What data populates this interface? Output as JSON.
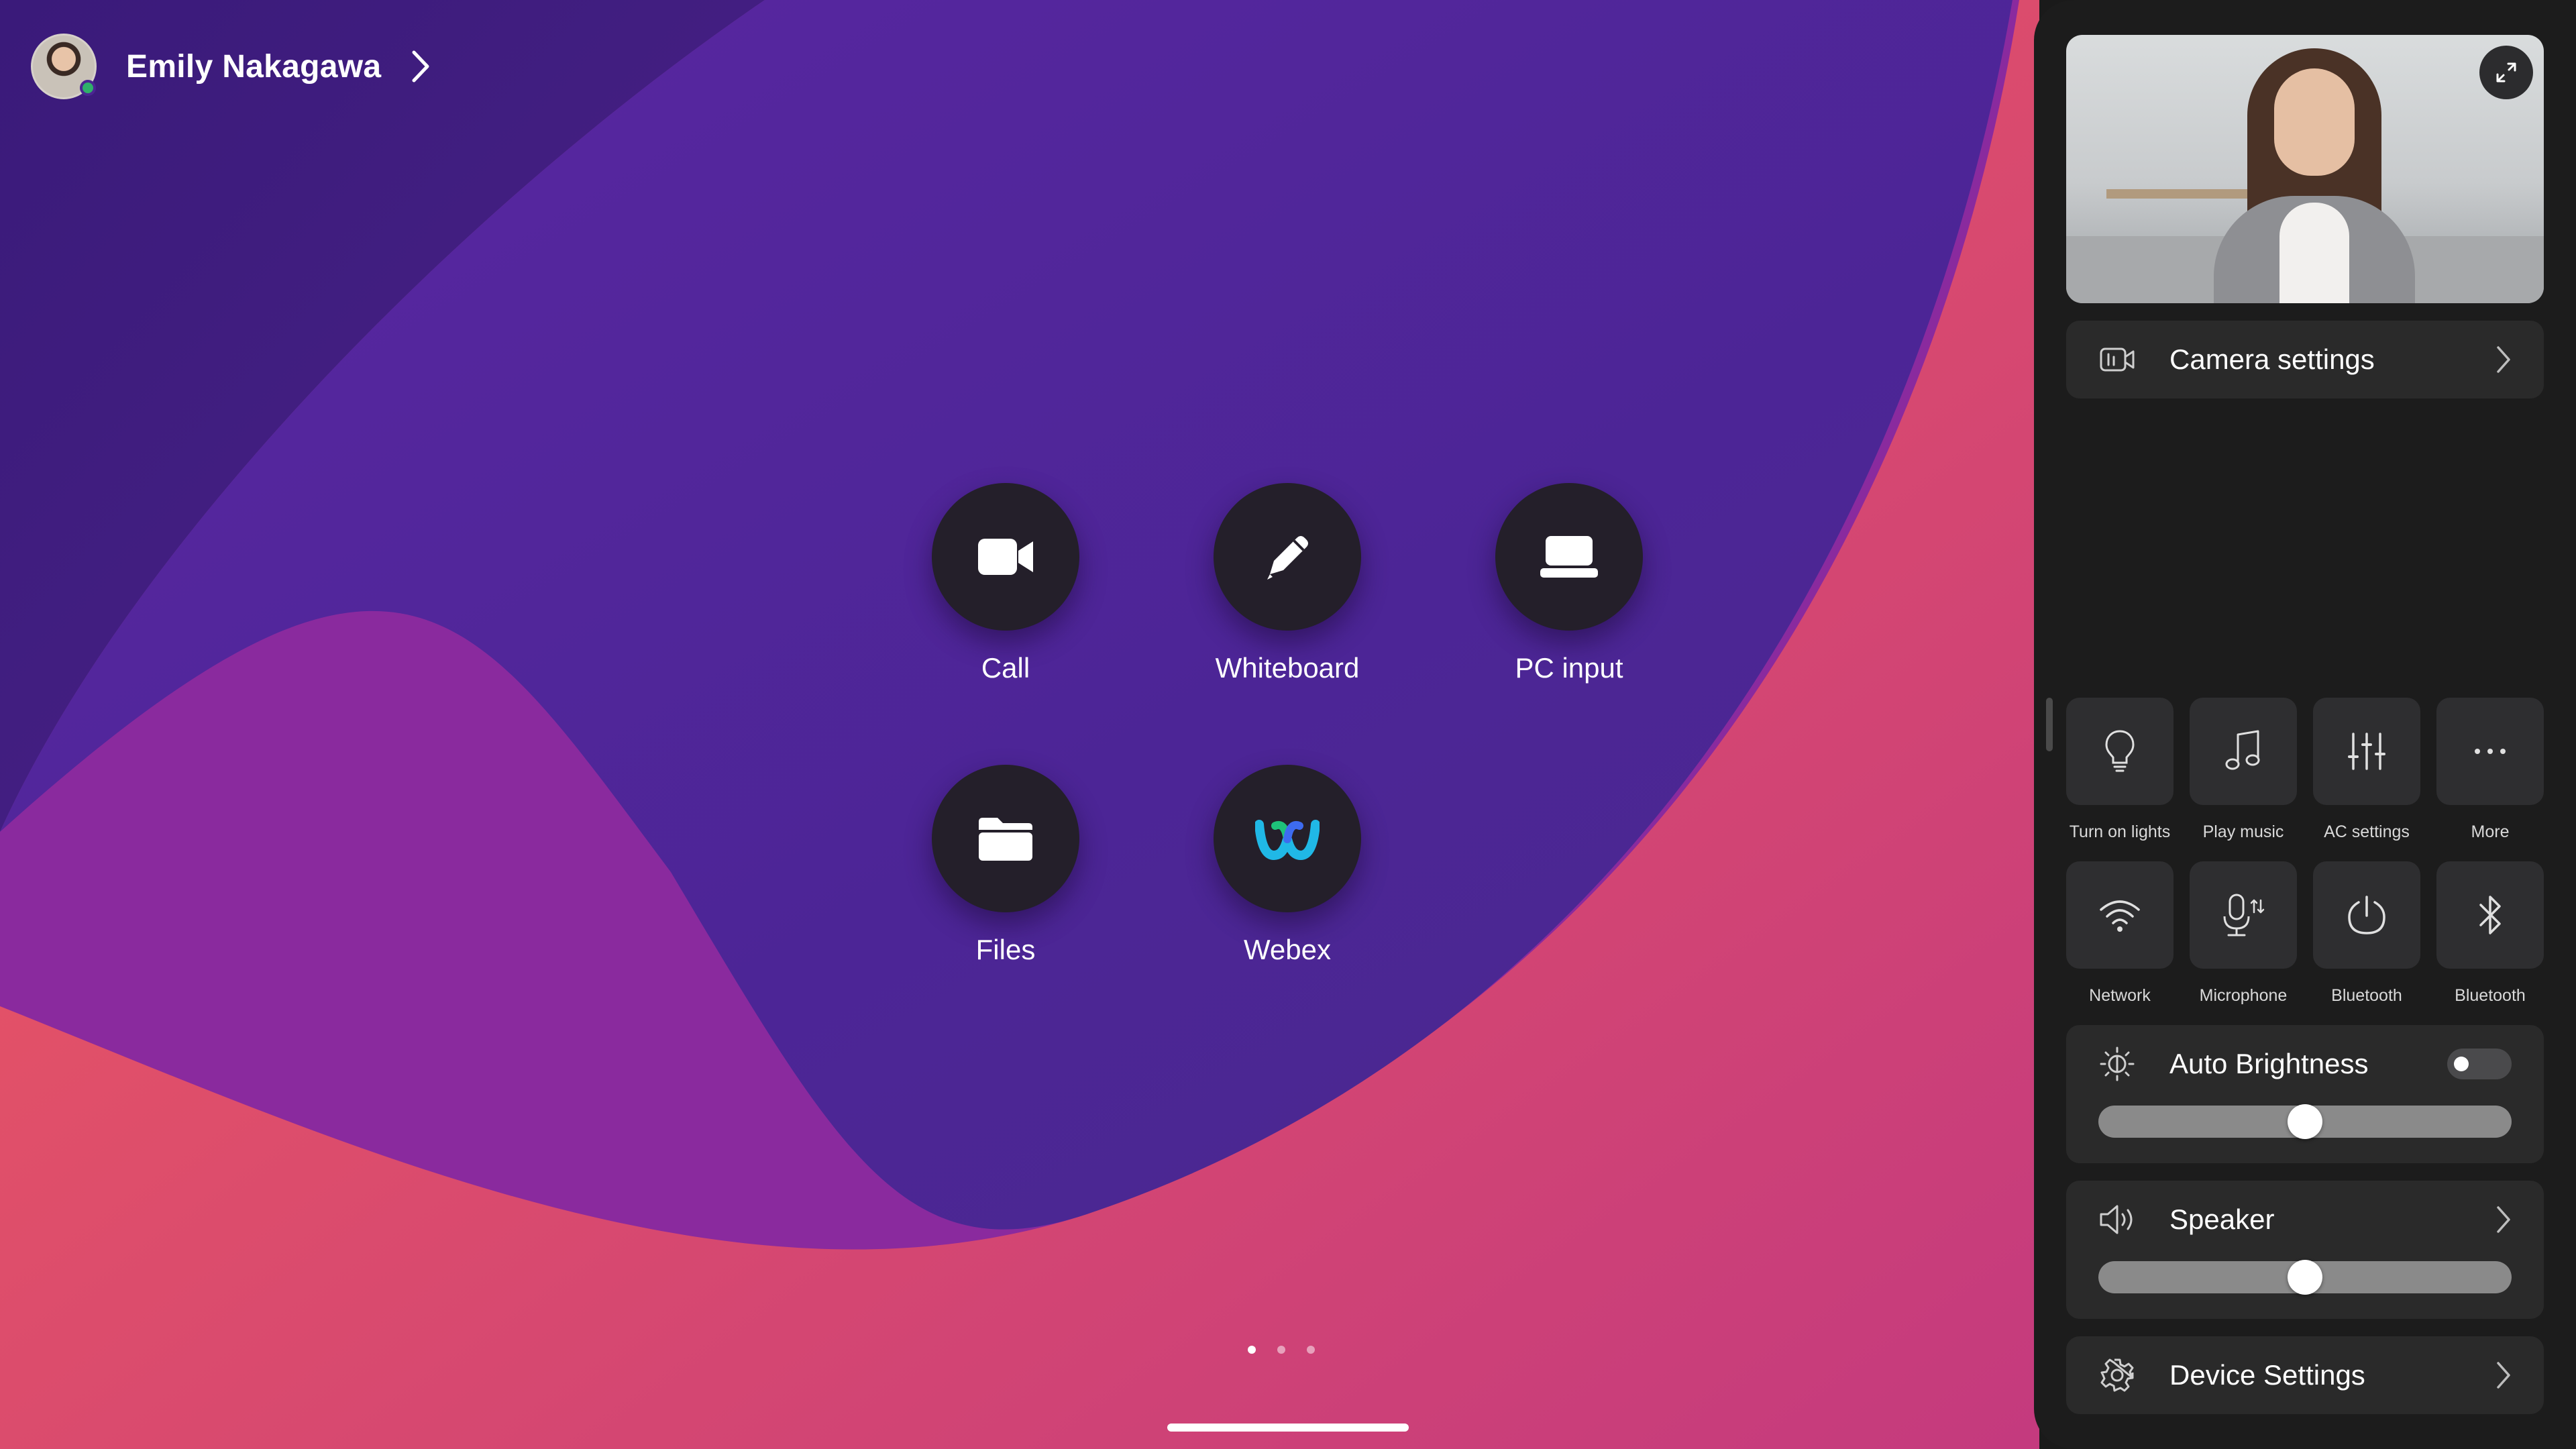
{
  "user": {
    "name": "Emily Nakagawa",
    "presence": "online",
    "presence_color": "#2fb06a"
  },
  "launcher": {
    "apps": [
      {
        "label": "Call",
        "icon": "video-camera-icon"
      },
      {
        "label": "Whiteboard",
        "icon": "pencil-icon"
      },
      {
        "label": "PC input",
        "icon": "laptop-icon"
      },
      {
        "label": "Files",
        "icon": "folder-icon"
      },
      {
        "label": "Webex",
        "icon": "webex-logo-icon"
      }
    ],
    "page_count": 3,
    "current_page": 1
  },
  "panel": {
    "camera_settings_label": "Camera settings",
    "quick_actions": [
      {
        "label": "Turn on lights",
        "icon": "lightbulb-icon"
      },
      {
        "label": "Play music",
        "icon": "music-note-icon"
      },
      {
        "label": "AC settings",
        "icon": "sliders-icon"
      },
      {
        "label": "More",
        "icon": "more-dots-icon"
      },
      {
        "label": "Network",
        "icon": "wifi-icon"
      },
      {
        "label": "Microphone",
        "icon": "microphone-icon"
      },
      {
        "label": "Bluetooth",
        "icon": "power-icon"
      },
      {
        "label": "Bluetooth",
        "icon": "bluetooth-icon"
      }
    ],
    "brightness": {
      "label": "Auto Brightness",
      "auto": false,
      "level": 0.5
    },
    "speaker": {
      "label": "Speaker",
      "level": 0.5
    },
    "device_settings_label": "Device Settings"
  },
  "colors": {
    "panel_bg": "#1c1c1c",
    "tile_bg": "#2e2e30",
    "app_circle": "#241f2a",
    "accent_wallpaper": "#6a2cae"
  }
}
